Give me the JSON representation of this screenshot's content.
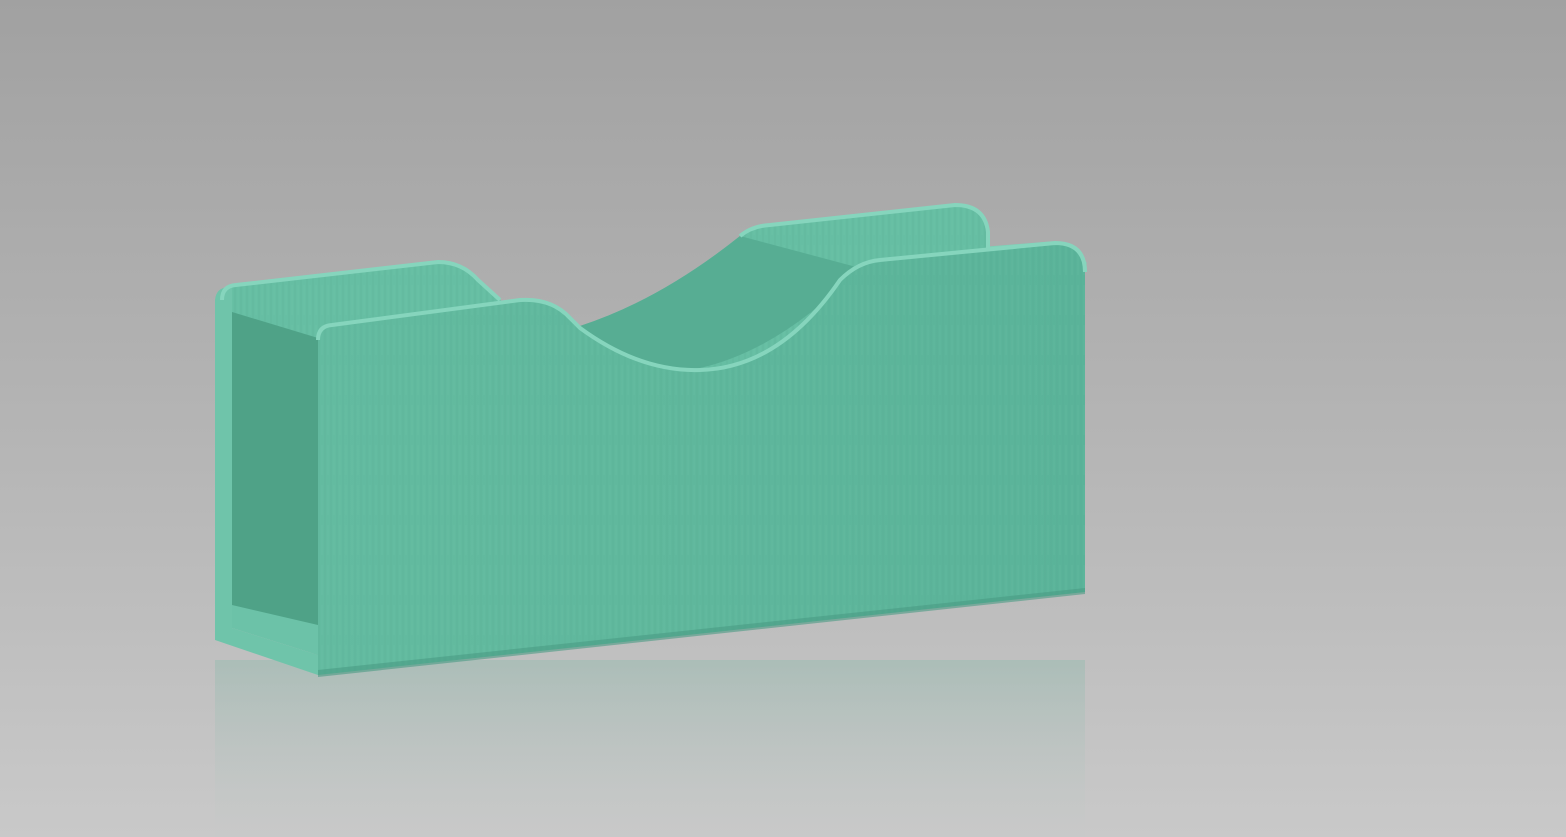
{
  "scene": {
    "subject": "card-holder-stand",
    "colors": {
      "background_top": "#a1a1a1",
      "background_mid": "#b6b6b6",
      "background_floor": "#c9c9c9",
      "body": "#5fb79c",
      "body_light": "#77c8af",
      "body_dark": "#4a9b83",
      "interior_shadow": "#3f8a73",
      "reflection": "#9fbcb3"
    }
  }
}
